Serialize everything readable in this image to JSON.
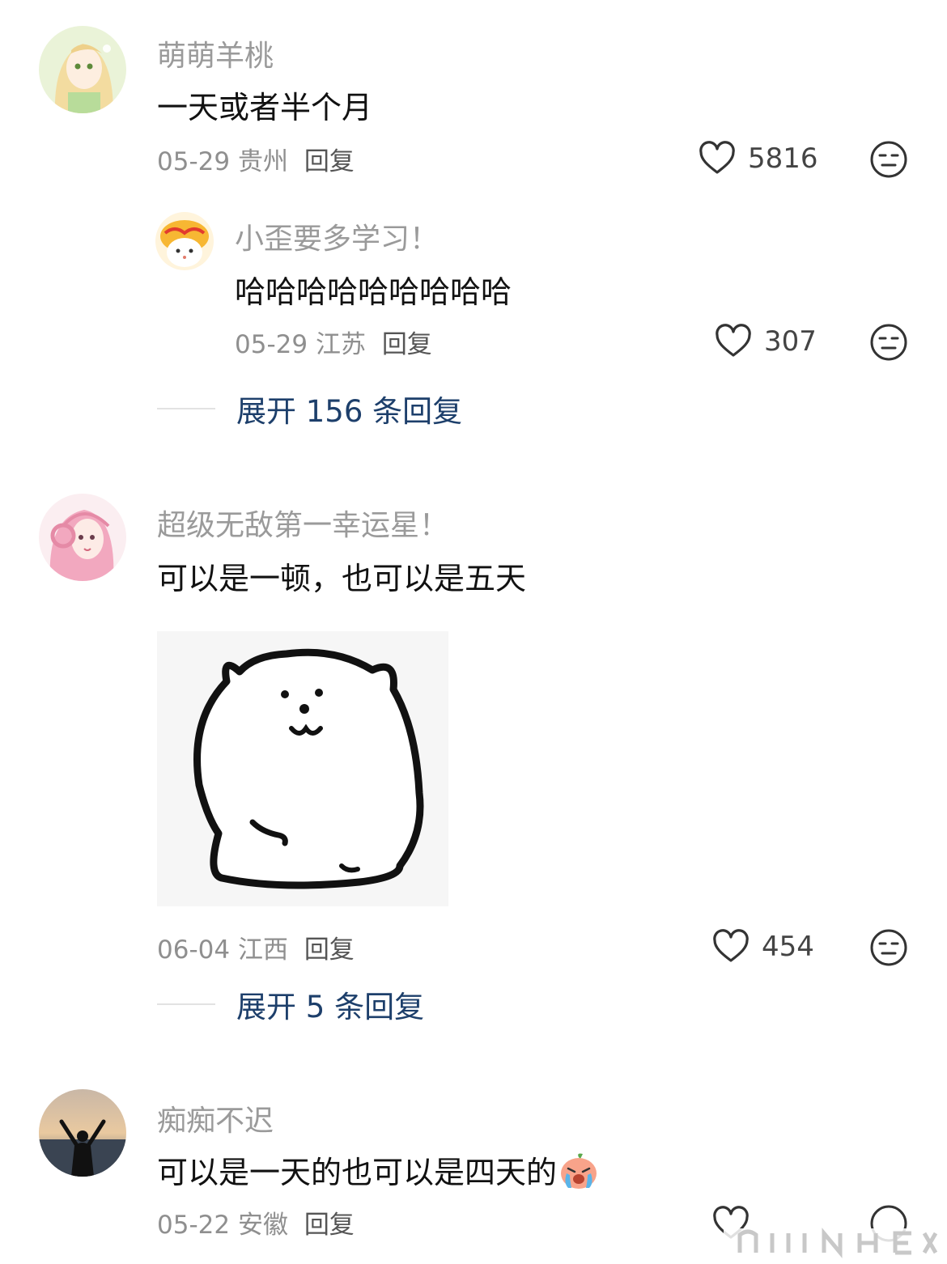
{
  "comments": [
    {
      "username": "萌萌羊桃",
      "text": "一天或者半个月",
      "date": "05-29",
      "location": "贵州",
      "reply_label": "回复",
      "likes": "5816",
      "sub_reply": {
        "username": "小歪要多学习！",
        "text": "哈哈哈哈哈哈哈哈哈",
        "date": "05-29",
        "location": "江苏",
        "reply_label": "回复",
        "likes": "307"
      },
      "expand_label": "展开 156 条回复"
    },
    {
      "username": "超级无敌第一幸运星！",
      "text": "可以是一顿，也可以是五天",
      "sticker": "bear-sticker",
      "date": "06-04",
      "location": "江西",
      "reply_label": "回复",
      "likes": "454",
      "expand_label": "展开 5 条回复"
    },
    {
      "username": "痴痴不迟",
      "text": "可以是一天的也可以是四天的",
      "emoji": "crying-peach-emoji",
      "date": "05-22",
      "location": "安徽",
      "reply_label": "回复",
      "likes": ""
    }
  ],
  "colors": {
    "expand_link": "#1d3f6b",
    "username": "#9a9a9a",
    "meta": "#8f8f8f"
  },
  "icons": {
    "like": "heart-outline-icon",
    "dislike": "neutral-face-icon"
  }
}
